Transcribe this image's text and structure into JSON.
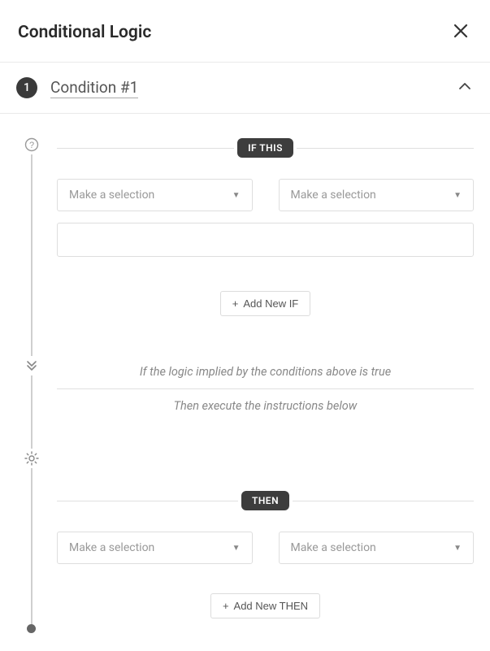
{
  "header": {
    "title": "Conditional Logic"
  },
  "condition": {
    "number": "1",
    "title": "Condition #1"
  },
  "ifSection": {
    "label": "IF THIS",
    "select1Placeholder": "Make a selection",
    "select2Placeholder": "Make a selection",
    "addButton": "Add New IF"
  },
  "midText": {
    "line1": "If the logic implied by the conditions above is true",
    "line2": "Then execute the instructions below"
  },
  "thenSection": {
    "label": "THEN",
    "select1Placeholder": "Make a selection",
    "select2Placeholder": "Make a selection",
    "addButton": "Add New THEN"
  }
}
